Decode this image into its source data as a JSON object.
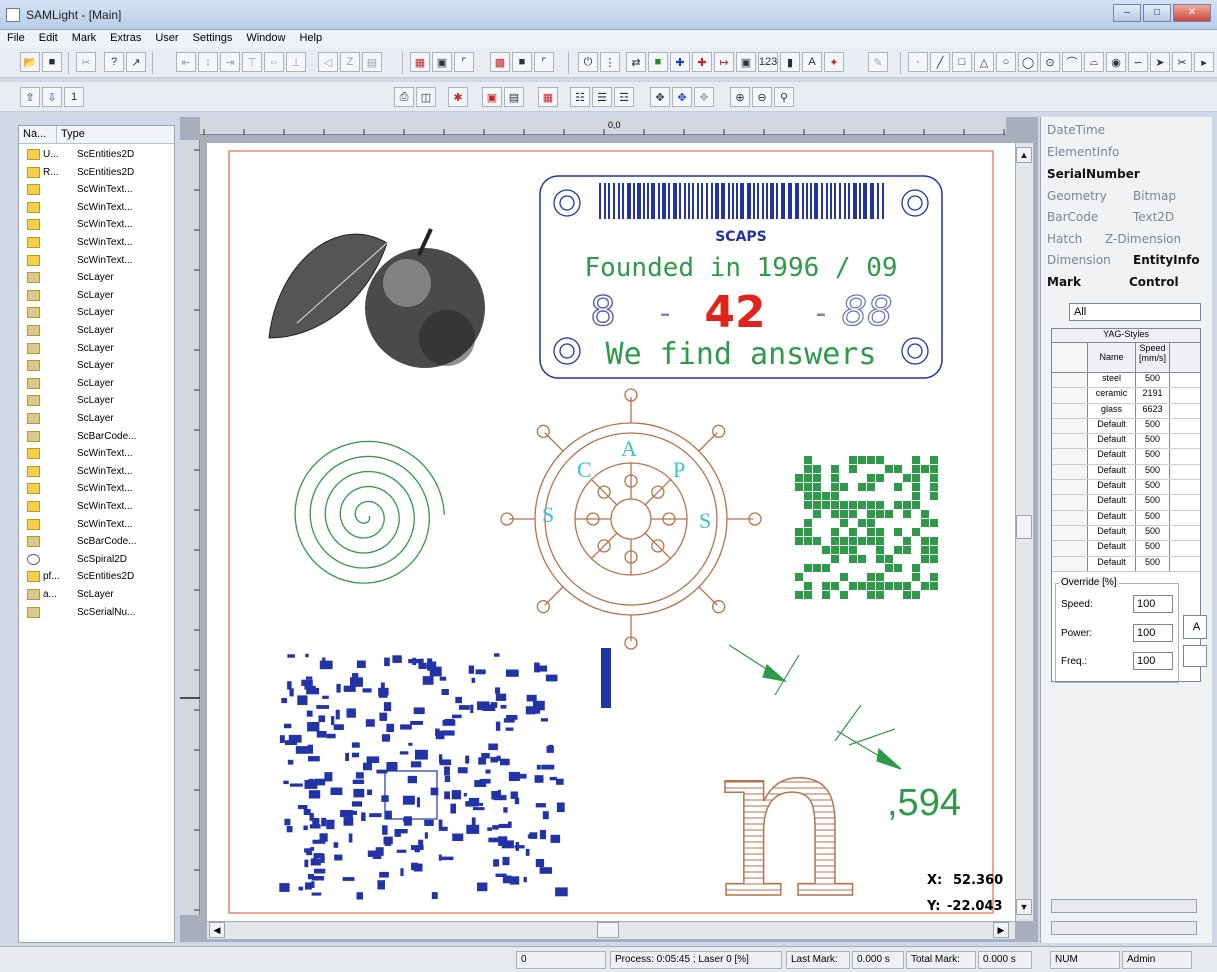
{
  "window": {
    "title": "SAMLight - [Main]"
  },
  "menu": [
    "File",
    "Edit",
    "Mark",
    "Extras",
    "User",
    "Settings",
    "Window",
    "Help"
  ],
  "tree": {
    "headers": [
      "Na...",
      "Type"
    ],
    "rows": [
      {
        "name": "U...",
        "type": "ScEntities2D",
        "icon": "folder-icon"
      },
      {
        "name": "R...",
        "type": "ScEntities2D",
        "icon": "folder-icon"
      },
      {
        "name": "",
        "type": "ScWinText...",
        "icon": "folder-icon"
      },
      {
        "name": "",
        "type": "ScWinText...",
        "icon": "folder-icon"
      },
      {
        "name": "",
        "type": "ScWinText...",
        "icon": "folder-icon"
      },
      {
        "name": "",
        "type": "ScWinText...",
        "icon": "folder-icon"
      },
      {
        "name": "",
        "type": "ScWinText...",
        "icon": "folder-icon"
      },
      {
        "name": "",
        "type": "ScLayer",
        "icon": "layer-icon"
      },
      {
        "name": "",
        "type": "ScLayer",
        "icon": "layer-icon"
      },
      {
        "name": "",
        "type": "ScLayer",
        "icon": "layer-icon"
      },
      {
        "name": "",
        "type": "ScLayer",
        "icon": "layer-icon"
      },
      {
        "name": "",
        "type": "ScLayer",
        "icon": "layer-icon"
      },
      {
        "name": "",
        "type": "ScLayer",
        "icon": "layer-icon"
      },
      {
        "name": "",
        "type": "ScLayer",
        "icon": "layer-icon"
      },
      {
        "name": "",
        "type": "ScLayer",
        "icon": "layer-icon"
      },
      {
        "name": "",
        "type": "ScLayer",
        "icon": "layer-icon"
      },
      {
        "name": "",
        "type": "ScBarCode...",
        "icon": "layer-icon"
      },
      {
        "name": "",
        "type": "ScWinText...",
        "icon": "folder-icon"
      },
      {
        "name": "",
        "type": "ScWinText...",
        "icon": "folder-icon"
      },
      {
        "name": "",
        "type": "ScWinText...",
        "icon": "folder-icon"
      },
      {
        "name": "",
        "type": "ScWinText...",
        "icon": "folder-icon"
      },
      {
        "name": "",
        "type": "ScWinText...",
        "icon": "folder-icon"
      },
      {
        "name": "",
        "type": "ScBarCode...",
        "icon": "layer-icon"
      },
      {
        "name": "",
        "type": "ScSpiral2D",
        "icon": "spiral-icon"
      },
      {
        "name": "pf...",
        "type": "ScEntities2D",
        "icon": "folder-icon"
      },
      {
        "name": "a...",
        "type": "ScLayer",
        "icon": "layer-icon"
      },
      {
        "name": "",
        "type": "ScSerialNu...",
        "icon": "layer-icon"
      }
    ]
  },
  "canvas": {
    "ruler_origin": "0,0",
    "plate_brand": "SCAPS",
    "plate_founded": "Founded in 1996 / 09",
    "serial_left": "8",
    "serial_dash1": "-",
    "serial_mid": "42",
    "serial_dash2": "-",
    "serial_right": "88",
    "plate_slogan": "We find answers",
    "wheel_letters": [
      "C",
      "A",
      "P",
      "S",
      "S"
    ],
    "letter_n": "n",
    "dimension": ",594",
    "coord_x_label": "X:",
    "coord_x": "52.360",
    "coord_y_label": "Y:",
    "coord_y": "-22.043"
  },
  "right": {
    "tabs_top": [
      "DateTime",
      "ElementInfo",
      "SerialNumber"
    ],
    "tabs_row1": [
      "Geometry",
      "Bitmap"
    ],
    "tabs_row2": [
      "BarCode",
      "Text2D"
    ],
    "tabs_row3": [
      "Hatch",
      "Z-Dimension"
    ],
    "tabs_row4": [
      "Dimension",
      "EntityInfo"
    ],
    "tabs_row5": [
      "Mark",
      "Control"
    ],
    "filter": "All",
    "table_title": "YAG-Styles",
    "col_name": "Name",
    "col_speed": "Speed [mm/s]",
    "styles": [
      {
        "name": "steel",
        "speed": "500"
      },
      {
        "name": "ceramic",
        "speed": "2191"
      },
      {
        "name": "glass",
        "speed": "6623"
      },
      {
        "name": "Default",
        "speed": "500"
      },
      {
        "name": "Default",
        "speed": "500"
      },
      {
        "name": "Default",
        "speed": "500"
      },
      {
        "name": "Default",
        "speed": "500"
      },
      {
        "name": "Default",
        "speed": "500"
      },
      {
        "name": "Default",
        "speed": "500"
      },
      {
        "name": "Default",
        "speed": "500"
      },
      {
        "name": "Default",
        "speed": "500"
      },
      {
        "name": "Default",
        "speed": "500"
      },
      {
        "name": "Default",
        "speed": "500"
      }
    ],
    "override_title": "Override [%]",
    "speed_label": "Speed:",
    "speed_value": "100",
    "power_label": "Power:",
    "power_value": "100",
    "freq_label": "Freq.:",
    "freq_value": "100",
    "side_button": "A"
  },
  "status": {
    "field1": "0",
    "process": "Process: 0:05:45 ; Laser 0 [%]",
    "last_mark_label": "Last Mark:",
    "last_mark": "0.000 s",
    "total_mark_label": "Total Mark:",
    "total_mark": "0.000 s",
    "num": "NUM",
    "user": "Admin"
  },
  "colors": {
    "blue": "#2233a8",
    "red": "#e0241c",
    "green": "#2e9a4a",
    "brown": "#b8724a",
    "cyan": "#3bc0d8",
    "frame": "#e8866c"
  }
}
